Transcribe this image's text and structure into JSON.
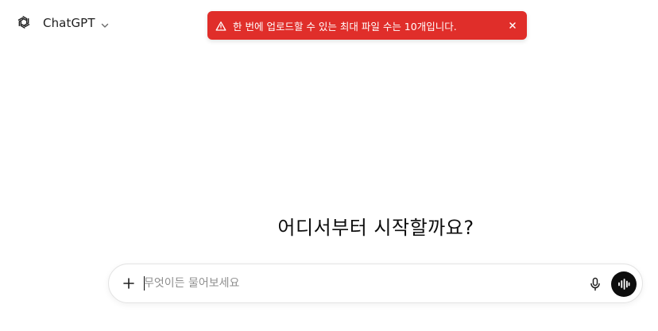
{
  "header": {
    "model_name": "ChatGPT",
    "logo_icon": "openai-logo-icon",
    "model_menu_icon": "chevron-down-icon"
  },
  "toast": {
    "icon": "warning-triangle-icon",
    "message": "한 번에 업로드할 수 있는 최대 파일 수는 10개입니다.",
    "close_icon": "close-icon",
    "close_symbol": "×",
    "background_color": "#e02e2a"
  },
  "main": {
    "headline": "어디서부터 시작할까요?"
  },
  "composer": {
    "placeholder": "무엇이든 물어보세요",
    "value": "",
    "plus_icon": "plus-icon",
    "mic_icon": "microphone-icon",
    "voice_icon": "voice-mode-icon"
  }
}
